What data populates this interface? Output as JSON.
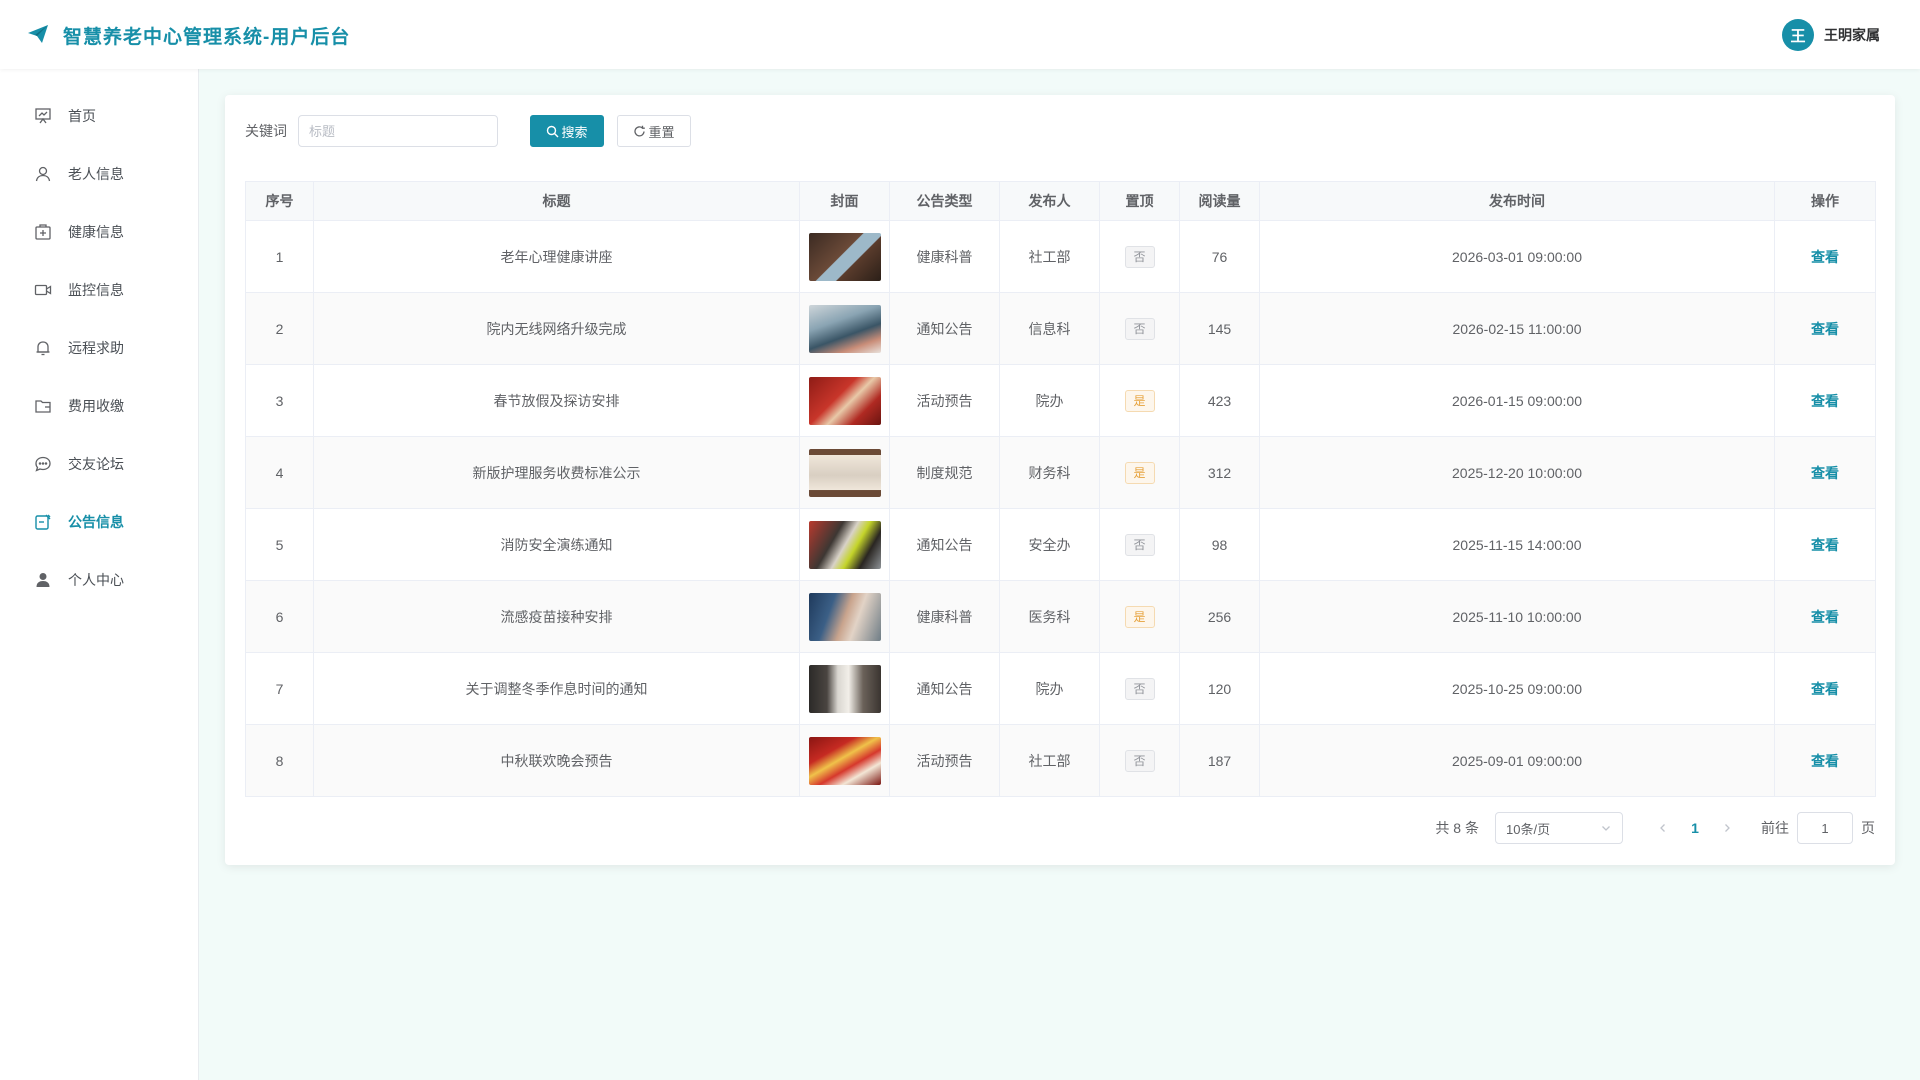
{
  "header": {
    "title": "智慧养老中心管理系统-用户后台",
    "avatar_char": "王",
    "user_name": "王明家属"
  },
  "sidebar": {
    "items": [
      {
        "label": "首页",
        "icon": "monitor-chart-icon"
      },
      {
        "label": "老人信息",
        "icon": "user-icon"
      },
      {
        "label": "健康信息",
        "icon": "medical-box-icon"
      },
      {
        "label": "监控信息",
        "icon": "camera-icon"
      },
      {
        "label": "远程求助",
        "icon": "bell-icon"
      },
      {
        "label": "费用收缴",
        "icon": "wallet-icon"
      },
      {
        "label": "交友论坛",
        "icon": "chat-icon"
      },
      {
        "label": "公告信息",
        "icon": "notice-icon",
        "active": true
      },
      {
        "label": "个人中心",
        "icon": "user-filled-icon"
      }
    ]
  },
  "search": {
    "label": "关键词",
    "placeholder": "标题",
    "search_btn": "搜索",
    "reset_btn": "重置"
  },
  "table": {
    "headers": [
      "序号",
      "标题",
      "封面",
      "公告类型",
      "发布人",
      "置顶",
      "阅读量",
      "发布时间",
      "操作"
    ],
    "rows": [
      {
        "no": "1",
        "title": "老年心理健康讲座",
        "type": "健康科普",
        "publisher": "社工部",
        "pinned": "否",
        "reads": "76",
        "time": "2026-03-01 09:00:00",
        "action": "查看"
      },
      {
        "no": "2",
        "title": "院内无线网络升级完成",
        "type": "通知公告",
        "publisher": "信息科",
        "pinned": "否",
        "reads": "145",
        "time": "2026-02-15 11:00:00",
        "action": "查看"
      },
      {
        "no": "3",
        "title": "春节放假及探访安排",
        "type": "活动预告",
        "publisher": "院办",
        "pinned": "是",
        "reads": "423",
        "time": "2026-01-15 09:00:00",
        "action": "查看"
      },
      {
        "no": "4",
        "title": "新版护理服务收费标准公示",
        "type": "制度规范",
        "publisher": "财务科",
        "pinned": "是",
        "reads": "312",
        "time": "2025-12-20 10:00:00",
        "action": "查看"
      },
      {
        "no": "5",
        "title": "消防安全演练通知",
        "type": "通知公告",
        "publisher": "安全办",
        "pinned": "否",
        "reads": "98",
        "time": "2025-11-15 14:00:00",
        "action": "查看"
      },
      {
        "no": "6",
        "title": "流感疫苗接种安排",
        "type": "健康科普",
        "publisher": "医务科",
        "pinned": "是",
        "reads": "256",
        "time": "2025-11-10 10:00:00",
        "action": "查看"
      },
      {
        "no": "7",
        "title": "关于调整冬季作息时间的通知",
        "type": "通知公告",
        "publisher": "院办",
        "pinned": "否",
        "reads": "120",
        "time": "2025-10-25 09:00:00",
        "action": "查看"
      },
      {
        "no": "8",
        "title": "中秋联欢晚会预告",
        "type": "活动预告",
        "publisher": "社工部",
        "pinned": "否",
        "reads": "187",
        "time": "2025-09-01 09:00:00",
        "action": "查看"
      }
    ]
  },
  "pagination": {
    "total_text": "共 8 条",
    "page_size": "10条/页",
    "current_page": "1",
    "goto_label": "前往",
    "goto_value": "1",
    "page_suffix": "页"
  },
  "colors": {
    "accent": "#178fa8",
    "pinned_yes": "#e6a23c",
    "pinned_no": "#909399"
  }
}
